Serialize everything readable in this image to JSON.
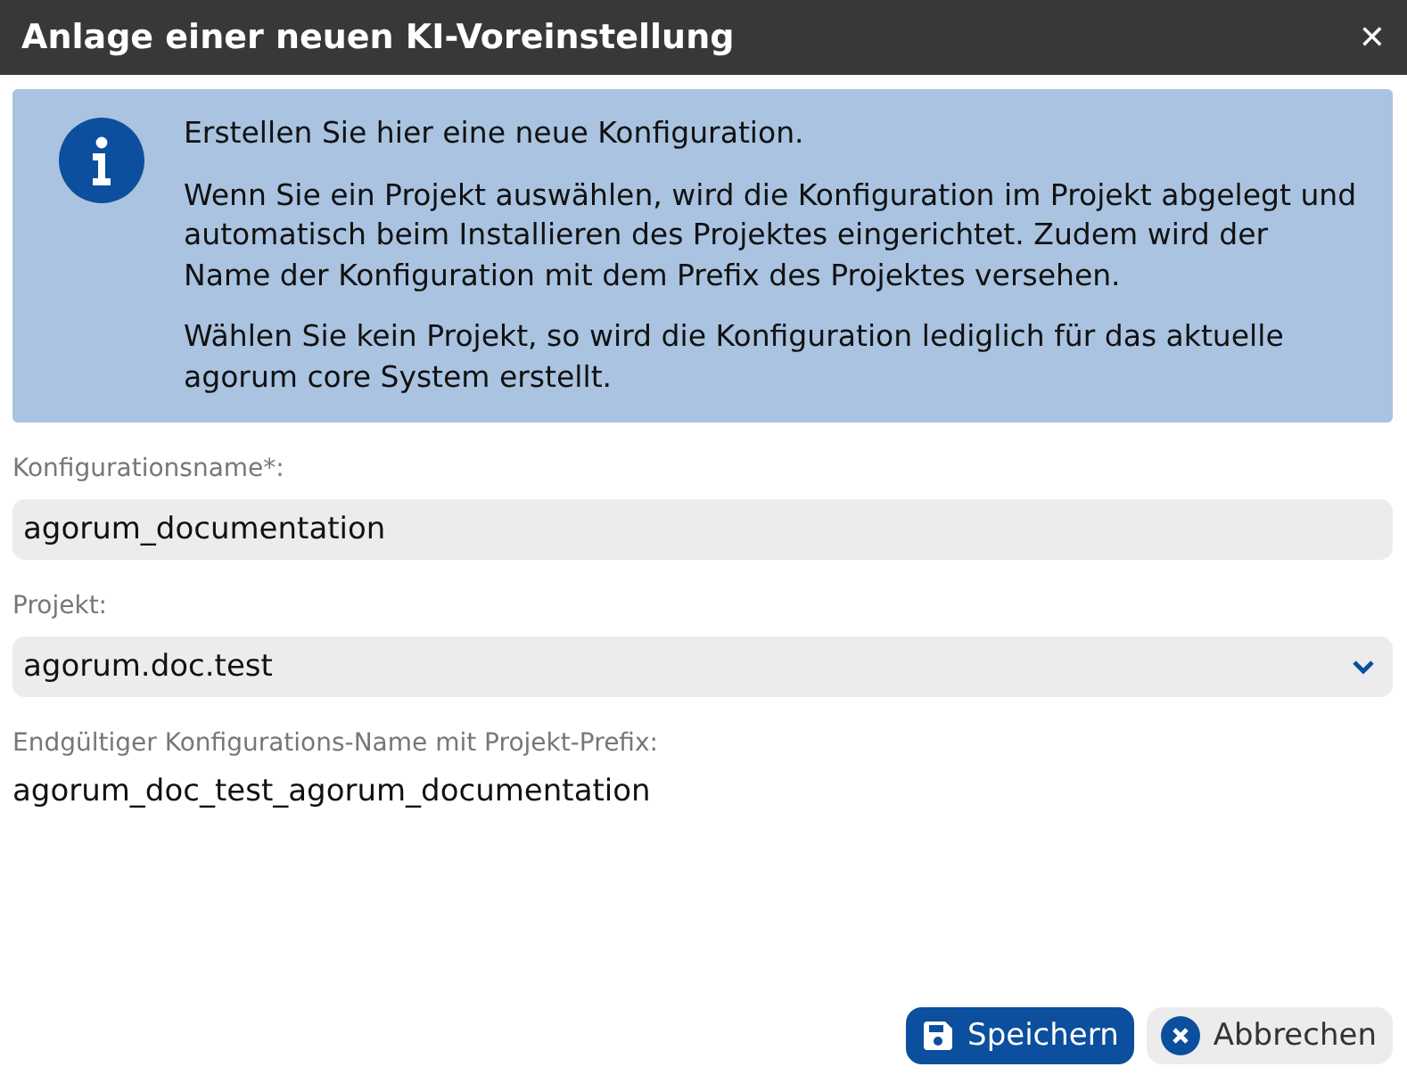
{
  "window": {
    "title": "Anlage einer neuen KI-Voreinstellung",
    "close": "✕"
  },
  "info": {
    "paragraphs": [
      "Erstellen Sie hier eine neue Konfiguration.",
      "Wenn Sie ein Projekt auswählen, wird die Konfiguration im Projekt abgelegt und automatisch beim Installieren des Projektes eingerichtet. Zudem wird der Name der Konfiguration mit dem Prefix des Projektes versehen.",
      "Wählen Sie kein Projekt, so wird die Konfiguration lediglich für das aktuelle agorum core System erstellt."
    ]
  },
  "fields": [
    {
      "kind": "text",
      "label": "Konfigurationsname*:",
      "value": "agorum_documentation"
    },
    {
      "kind": "select",
      "label": "Projekt:",
      "value": "agorum.doc.test"
    },
    {
      "kind": "readonly",
      "label": "Endgültiger Konfigurations-Name mit Projekt-Prefix:",
      "value": "agorum_doc_test_agorum_documentation"
    }
  ],
  "buttons": [
    {
      "kind": "save",
      "label": "Speichern"
    },
    {
      "kind": "cancel",
      "label": "Abbrechen"
    }
  ]
}
